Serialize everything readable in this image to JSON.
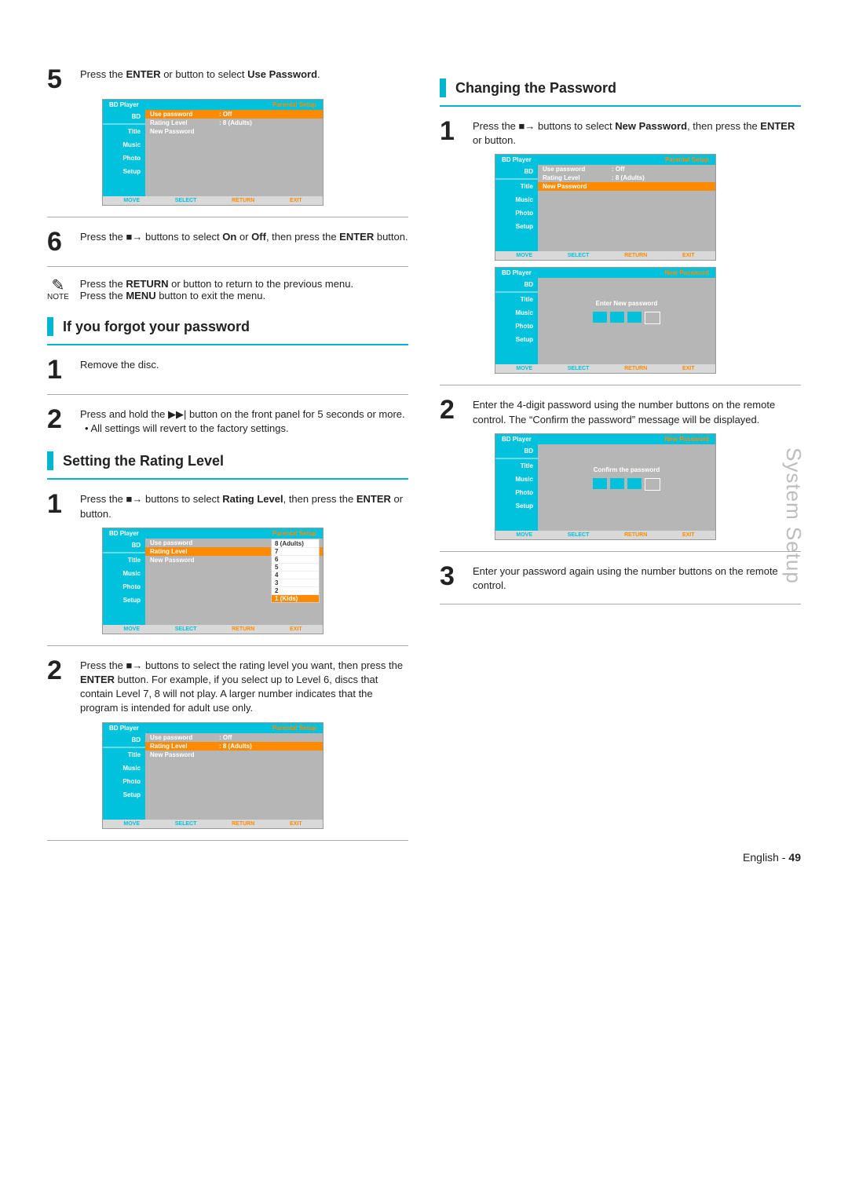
{
  "side_tab": "System Setup",
  "footer_lang": "English",
  "footer_page": "49",
  "left": {
    "step5_a": "Press the ",
    "step5_b": "ENTER",
    "step5_c": " or      button to select ",
    "step5_d": "Use Password",
    "step5_e": ".",
    "step6_a": "Press the ",
    "step6_b": " buttons to select ",
    "step6_c": "On",
    "step6_d": " or ",
    "step6_e": "Off",
    "step6_f": ", then press the ",
    "step6_g": "ENTER",
    "step6_h": " button.",
    "note_label": "NOTE",
    "note_line1_a": "Press the ",
    "note_line1_b": "RETURN",
    "note_line1_c": " or      button to return to the previous menu.",
    "note_line2_a": "Press the ",
    "note_line2_b": "MENU",
    "note_line2_c": " button to exit the menu.",
    "h_forgot": "If you forgot your password",
    "forgot_step1": "Remove the disc.",
    "forgot_step2_a": "Press and hold the ",
    "forgot_step2_b": " button on the front panel for 5 seconds or more.",
    "forgot_step2_bullet": "• All settings will revert to the factory settings.",
    "h_rating": "Setting the Rating Level",
    "rating_step1_a": "Press the ",
    "rating_step1_b": " buttons to select ",
    "rating_step1_c": "Rating Level",
    "rating_step1_d": ", then press the ",
    "rating_step1_e": "ENTER",
    "rating_step1_f": " or      button.",
    "rating_step2_a": "Press the ",
    "rating_step2_b": " buttons to select the rating level you want, then press the ",
    "rating_step2_c": "ENTER",
    "rating_step2_d": " button. For example, if you select up to Level 6, discs that contain Level 7, 8 will not play. A larger number indicates that the program is intended for adult use only."
  },
  "right": {
    "h_change": "Changing the Password",
    "cp_step1_a": "Press the ",
    "cp_step1_b": " buttons to select ",
    "cp_step1_c": "New Password",
    "cp_step1_d": ", then press the ",
    "cp_step1_e": "ENTER",
    "cp_step1_f": " or      button.",
    "cp_step2": "Enter the 4-digit password using the number buttons on the remote control. The “Confirm the password” message will be displayed.",
    "cp_step3": "Enter your password again using the number buttons on the remote control."
  },
  "osd": {
    "title_left": "BD Player",
    "title_right_parental": "Parental Setup",
    "title_right_newpw": "New Password",
    "side": [
      "BD",
      "Title",
      "Music",
      "Photo",
      "Setup"
    ],
    "rows": {
      "use_password": "Use password",
      "off": ": Off",
      "rating_level": "Rating Level",
      "eight_adults": ": 8 (Adults)",
      "new_password": "New Password"
    },
    "dropdown": [
      "8 (Adults)",
      "7",
      "6",
      "5",
      "4",
      "3",
      "2",
      "1 (Kids)"
    ],
    "prompt_enter": "Enter New password",
    "prompt_confirm": "Confirm the password",
    "foot": {
      "move": "MOVE",
      "select": "SELECT",
      "return": "RETURN",
      "exit": "EXIT"
    }
  },
  "glyph": {
    "updown": "▲▼",
    "skip": "▶▶|",
    "right": "▶",
    "stopright": "■→"
  }
}
